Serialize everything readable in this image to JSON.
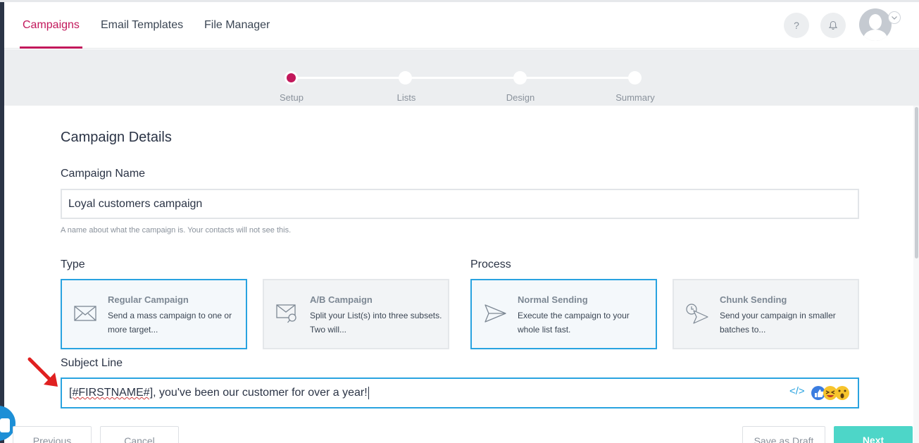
{
  "nav": {
    "tabs": [
      {
        "label": "Campaigns",
        "active": true
      },
      {
        "label": "Email Templates",
        "active": false
      },
      {
        "label": "File Manager",
        "active": false
      }
    ],
    "help_icon_text": "?",
    "icons": [
      "question-icon",
      "bell-icon",
      "avatar",
      "chevron-down-icon"
    ]
  },
  "stepper": {
    "steps": [
      {
        "label": "Setup",
        "state": "current"
      },
      {
        "label": "Lists",
        "state": "upcoming"
      },
      {
        "label": "Design",
        "state": "upcoming"
      },
      {
        "label": "Summary",
        "state": "upcoming"
      }
    ]
  },
  "form": {
    "section_title": "Campaign Details",
    "campaign_name": {
      "label": "Campaign Name",
      "value": "Loyal customers campaign",
      "hint": "A name about what the campaign is. Your contacts will not see this."
    },
    "type": {
      "label": "Type",
      "options": [
        {
          "title": "Regular Campaign",
          "desc": "Send a mass campaign to one or more target...",
          "icon": "envelope-icon",
          "selected": true
        },
        {
          "title": "A/B Campaign",
          "desc": "Split your List(s) into three subsets. Two will...",
          "icon": "envelope-search-icon",
          "selected": false
        }
      ]
    },
    "process": {
      "label": "Process",
      "options": [
        {
          "title": "Normal Sending",
          "desc": "Execute the campaign to your whole list fast.",
          "icon": "paper-plane-icon",
          "selected": true
        },
        {
          "title": "Chunk Sending",
          "desc": "Send your campaign in smaller batches to...",
          "icon": "clock-paper-plane-icon",
          "selected": false
        }
      ]
    },
    "subject": {
      "label": "Subject Line",
      "value_placeholder_token": "[#FIRSTNAME#]",
      "value_rest": ", you've been our customer for over a year!",
      "code_icon_text": "</>"
    }
  },
  "footer": {
    "previous": "Previous",
    "cancel": "Cancel",
    "save_draft": "Save as Draft",
    "next": "Next"
  },
  "colors": {
    "accent": "#c2185b",
    "focus_border": "#29a3e0",
    "next_button": "#4dd6c8",
    "stepper_bg": "#eceef0"
  }
}
